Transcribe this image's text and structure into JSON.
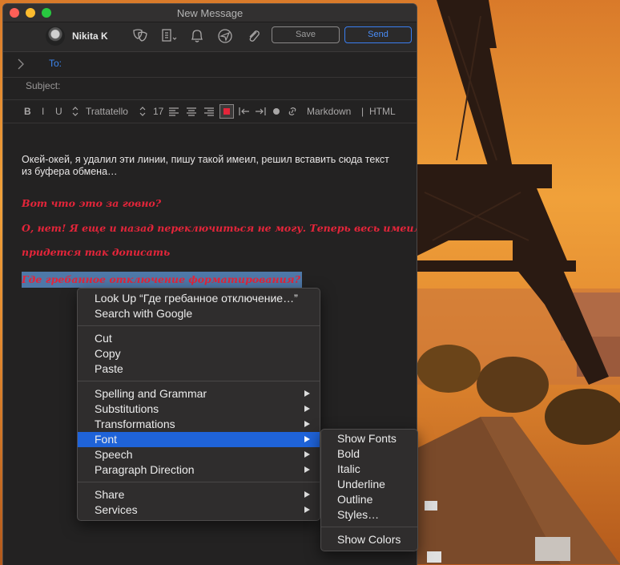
{
  "window": {
    "title": "New Message"
  },
  "toolbar": {
    "sender_name": "Nikita K",
    "save_label": "Save",
    "send_label": "Send"
  },
  "header_fields": {
    "to_label": "To:",
    "subject_label": "Subject:"
  },
  "format_bar": {
    "bold": "B",
    "italic": "I",
    "underline": "U",
    "font_name": "Trattatello",
    "font_size": "17",
    "markdown_label": "Markdown",
    "separator": "|",
    "html_label": "HTML",
    "text_color": "#e4253a"
  },
  "message": {
    "intro": "Окей-окей, я удалил эти линии, пишу такой имеил, решил вставить сюда текст из буфера обмена…",
    "red_lines": [
      "Вот что это за говно?",
      "О, нет! Я еще и назад переключиться не могу. Теперь весь имеил",
      "придется так дописать"
    ],
    "selected_line": "Где гребанное отключение форматирования?"
  },
  "context_menu": {
    "look_up": "Look Up “Где гребанное отключение…”",
    "search_google": "Search with Google",
    "cut": "Cut",
    "copy": "Copy",
    "paste": "Paste",
    "spelling": "Spelling and Grammar",
    "substitutions": "Substitutions",
    "transformations": "Transformations",
    "font": "Font",
    "speech": "Speech",
    "paragraph_direction": "Paragraph Direction",
    "share": "Share",
    "services": "Services"
  },
  "font_submenu": {
    "show_fonts": "Show Fonts",
    "bold": "Bold",
    "italic": "Italic",
    "underline": "Underline",
    "outline": "Outline",
    "styles": "Styles…",
    "show_colors": "Show Colors"
  },
  "colors": {
    "accent_blue": "#1f63d8",
    "selection": "#4e78a8"
  }
}
